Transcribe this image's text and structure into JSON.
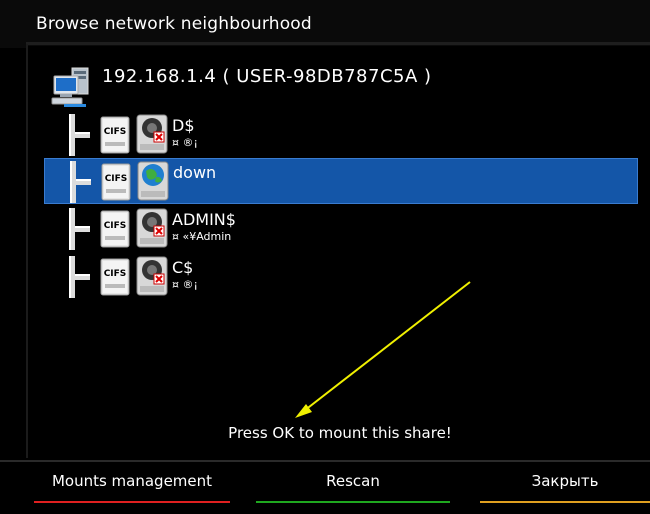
{
  "window": {
    "title": "Browse network neighbourhood"
  },
  "server": {
    "label": "192.168.1.4 ( USER-98DB787C5A )",
    "icon": "network-computer-icon"
  },
  "shares": [
    {
      "name": "D$",
      "comment": "¤ ®¡",
      "type_badge": "CIFS",
      "selected": false,
      "icon": "network-drive-icon"
    },
    {
      "name": "down",
      "comment": "",
      "type_badge": "CIFS",
      "selected": true,
      "icon": "globe-drive-icon"
    },
    {
      "name": "ADMIN$",
      "comment": "¤ «¥Admin",
      "type_badge": "CIFS",
      "selected": false,
      "icon": "network-drive-icon"
    },
    {
      "name": "C$",
      "comment": "¤ ®¡",
      "type_badge": "CIFS",
      "selected": false,
      "icon": "network-drive-icon"
    }
  ],
  "hint": "Press OK to mount this share!",
  "footer": {
    "buttons": [
      {
        "label": "Mounts management",
        "color": "#e02020"
      },
      {
        "label": "Rescan",
        "color": "#1fa81f"
      },
      {
        "label": "Закрыть",
        "color": "#e0a020"
      }
    ]
  },
  "colors": {
    "selection": "#1456a8",
    "arrow": "#f0f000"
  }
}
